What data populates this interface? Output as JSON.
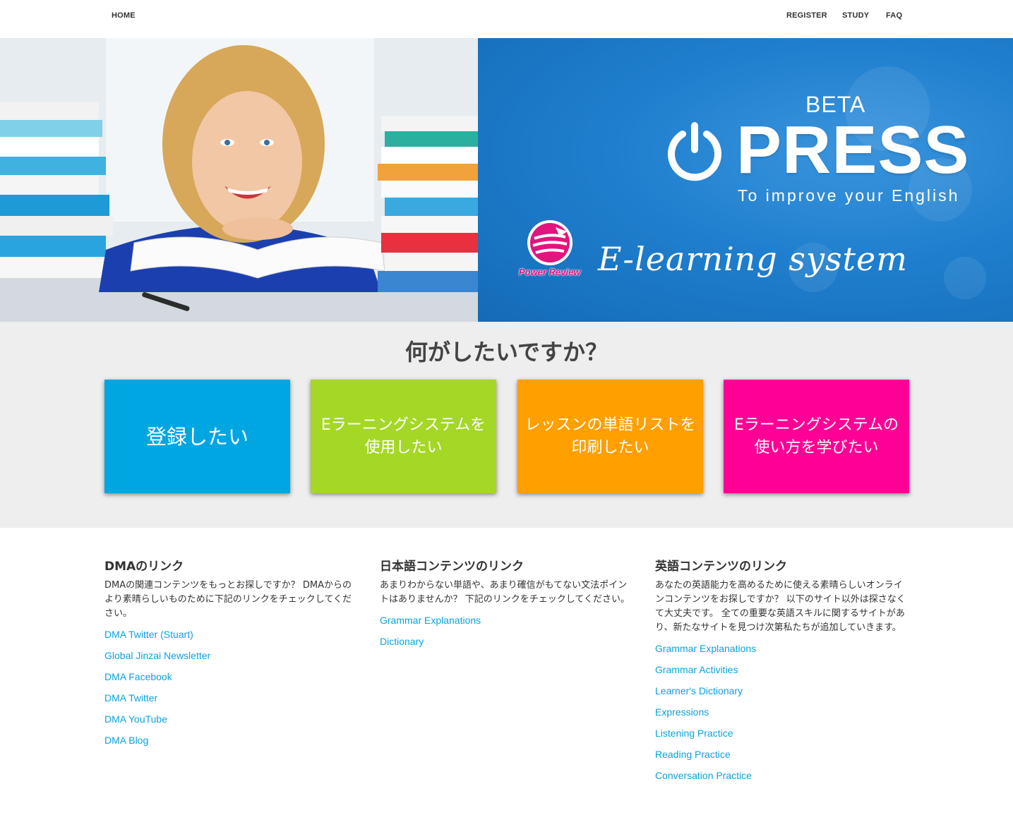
{
  "nav": {
    "home": "HOME",
    "register": "REGISTER",
    "study": "STUDY",
    "faq": "FAQ"
  },
  "hero": {
    "beta": "BETA",
    "press": "PRESS",
    "tagline": "To improve your English",
    "elearning": "E-learning system",
    "power_review": "Power Review",
    "slides": 4,
    "active_slide": 1
  },
  "question": {
    "title": "何がしたいですか？",
    "tiles": [
      {
        "label": "登録したい",
        "color": "#00a6e1"
      },
      {
        "label": "Eラーニングシステムを使用したい",
        "color": "#a5d727"
      },
      {
        "label": "レッスンの単語リストを印刷したい",
        "color": "#ff9f00"
      },
      {
        "label": "Eラーニングシステムの使い方を学びたい",
        "color": "#ff0096"
      }
    ]
  },
  "columns": {
    "dma": {
      "title": "DMAのリンク",
      "text": "DMAの関連コンテンツをもっとお探しですか？ DMAからのより素晴らしいものために下記のリンクをチェックしてください。",
      "links": [
        "DMA Twitter (Stuart)",
        "Global Jinzai Newsletter",
        "DMA Facebook",
        "DMA Twitter",
        "DMA YouTube",
        "DMA Blog"
      ]
    },
    "japanese": {
      "title": "日本語コンテンツのリンク",
      "text": "あまりわからない単語や、あまり確信がもてない文法ポイントはありませんか？ 下記のリンクをチェックしてください。",
      "links": [
        "Grammar Explanations",
        "Dictionary"
      ]
    },
    "english": {
      "title": "英語コンテンツのリンク",
      "text": "あなたの英語能力を高めるために使える素晴らしいオンラインコンテンツをお探しですか？ 以下のサイト以外は探さなくて大丈夫です。 全ての重要な英語スキルに関するサイトがあり、新たなサイトを見つけ次第私たちが追加していきます。",
      "links": [
        "Grammar Explanations",
        "Grammar Activities",
        "Learner's Dictionary",
        "Expressions",
        "Listening Practice",
        "Reading Practice",
        "Conversation Practice"
      ]
    }
  },
  "colors": {
    "link": "#0aa3e0",
    "band_bg": "#eeeeee",
    "hero_blue": "#1f7fce"
  }
}
